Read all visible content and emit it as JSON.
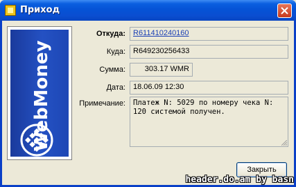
{
  "window": {
    "title": "Приход"
  },
  "side_panel": {
    "brand": "WebMoney"
  },
  "form": {
    "from_label": "Откуда:",
    "from_value": "R611410240160",
    "to_label": "Куда:",
    "to_value": "R649230256433",
    "amount_label": "Сумма:",
    "amount_value": "303.17 WMR",
    "date_label": "Дата:",
    "date_value": "18.06.09 12:30",
    "note_label": "Примечание:",
    "note_value": "Платеж N: 5029 по номеру чека N: 120 системой получен."
  },
  "buttons": {
    "close_label": "Закрыть"
  },
  "watermark": "header.do.am  by  basn",
  "colors": {
    "titlebar": "#0553d6",
    "link": "#1a3fb5",
    "panel": "#2451c3"
  }
}
